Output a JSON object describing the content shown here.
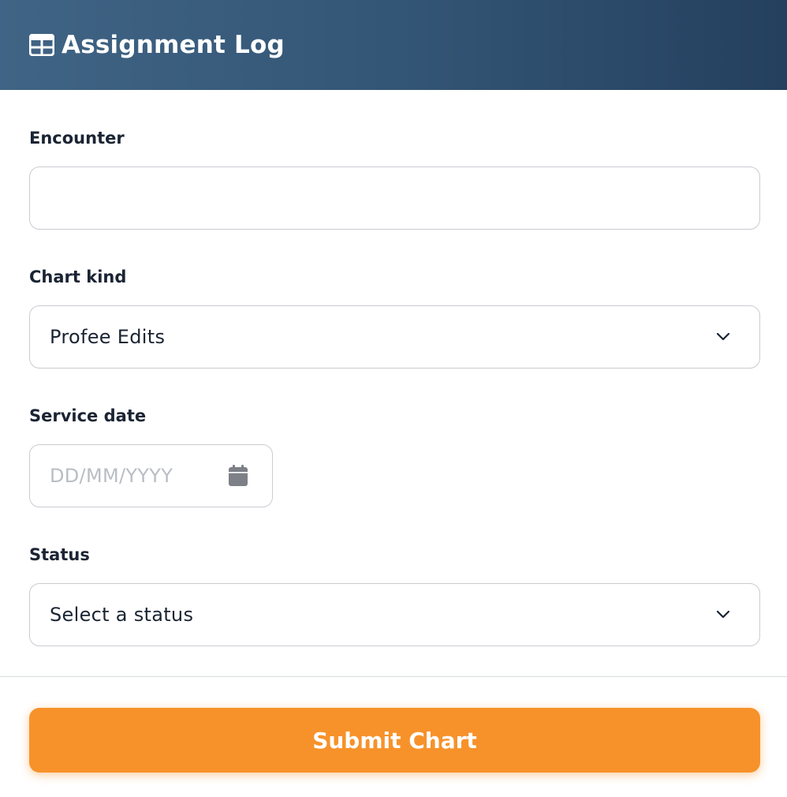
{
  "header": {
    "title": "Assignment Log",
    "icon": "table-icon"
  },
  "form": {
    "encounter": {
      "label": "Encounter",
      "value": ""
    },
    "chart_kind": {
      "label": "Chart kind",
      "selected": "Profee Edits"
    },
    "service_date": {
      "label": "Service date",
      "placeholder": "DD/MM/YYYY",
      "icon": "calendar-icon"
    },
    "status": {
      "label": "Status",
      "selected": "Select a status"
    }
  },
  "footer": {
    "submit_label": "Submit Chart"
  },
  "colors": {
    "header_gradient_start": "#406485",
    "header_gradient_end": "#24405e",
    "accent": "#f7922a"
  }
}
